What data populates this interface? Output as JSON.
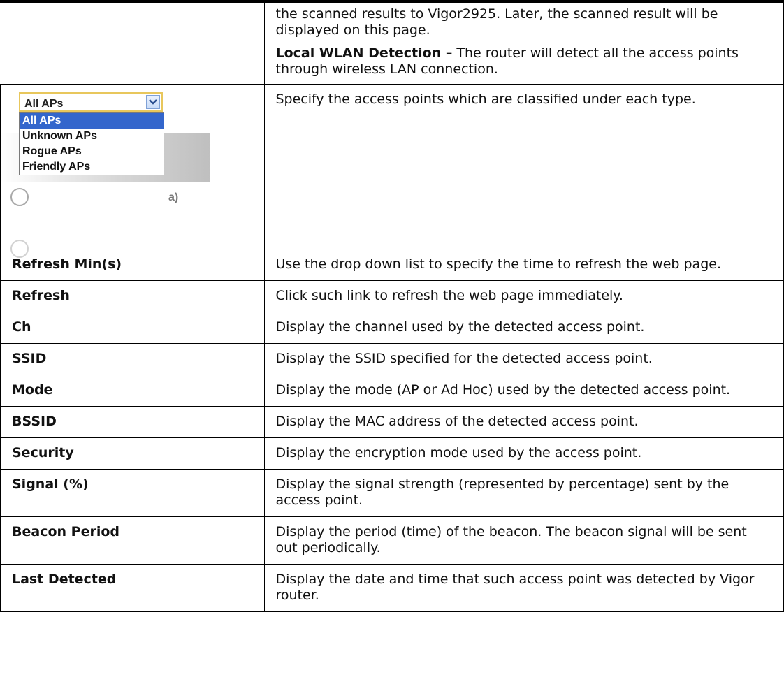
{
  "intro": {
    "line1": "the scanned results to Vigor2925. Later, the scanned result will be displayed on this page.",
    "local_label": "Local WLAN Detection –",
    "local_text": " The router will detect all the access points through wireless LAN connection."
  },
  "filter": {
    "selected": "All APs",
    "options": [
      "All APs",
      "Unknown APs",
      "Rogue APs",
      "Friendly APs"
    ],
    "ghost_text": "a)",
    "description": "Specify the access points which are classified under each type."
  },
  "rows": [
    {
      "term": "Refresh Min(s)",
      "desc": "Use the drop down list to specify the time to refresh the web page."
    },
    {
      "term": "Refresh",
      "desc": "Click such link to refresh the web page immediately."
    },
    {
      "term": "Ch",
      "desc": "Display the channel used by the detected access point."
    },
    {
      "term": "SSID",
      "desc": "Display the SSID specified for the detected access point."
    },
    {
      "term": "Mode",
      "desc": "Display the mode (AP or Ad Hoc) used by the detected access point."
    },
    {
      "term": "BSSID",
      "desc": "Display the MAC address of the detected access point."
    },
    {
      "term": "Security",
      "desc": "Display the encryption mode used by the access point."
    },
    {
      "term": "Signal (%)",
      "desc": "Display the signal strength (represented by percentage) sent by the access point."
    },
    {
      "term": "Beacon Period",
      "desc": "Display the period (time) of the beacon. The beacon signal will be sent out periodically."
    },
    {
      "term": "Last Detected",
      "desc": "Display the date and time that such access point was detected by Vigor router."
    }
  ]
}
